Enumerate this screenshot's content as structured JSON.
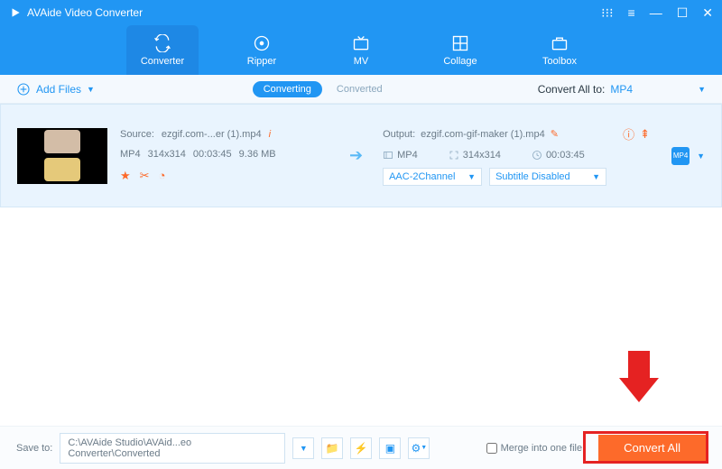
{
  "titlebar": {
    "app_name": "AVAide Video Converter"
  },
  "nav": {
    "converter": "Converter",
    "ripper": "Ripper",
    "mv": "MV",
    "collage": "Collage",
    "toolbox": "Toolbox"
  },
  "subbar": {
    "add_files": "Add Files",
    "tab_converting": "Converting",
    "tab_converted": "Converted",
    "convert_all_to": "Convert All to:",
    "format": "MP4"
  },
  "file": {
    "source_label": "Source:",
    "source_name": "ezgif.com-...er (1).mp4",
    "info_icon": "i",
    "src_format": "MP4",
    "src_res": "314x314",
    "src_dur": "00:03:45",
    "src_size": "9.36 MB",
    "output_label": "Output:",
    "output_name": "ezgif.com-gif-maker (1).mp4",
    "out_format": "MP4",
    "out_res": "314x314",
    "out_dur": "00:03:45",
    "audio_sel": "AAC-2Channel",
    "subtitle_sel": "Subtitle Disabled",
    "chip": "MP4"
  },
  "bottom": {
    "save_to": "Save to:",
    "path": "C:\\AVAide Studio\\AVAid...eo Converter\\Converted",
    "merge_label": "Merge into one file",
    "convert_all": "Convert All"
  }
}
